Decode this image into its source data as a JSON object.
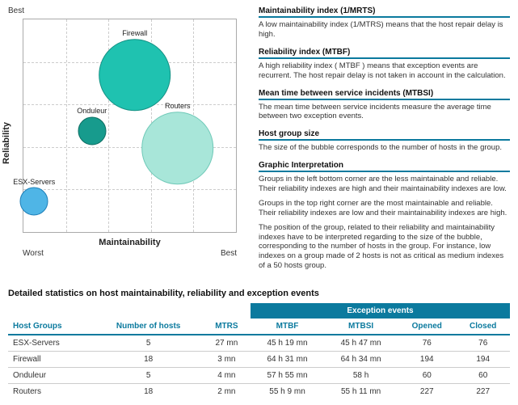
{
  "chart": {
    "best": "Best",
    "worst": "Worst",
    "xlabel": "Maintainability",
    "ylabel": "Reliability"
  },
  "chart_data": {
    "type": "scatter",
    "title": "",
    "xlabel": "Maintainability",
    "ylabel": "Reliability",
    "x_range": [
      "Worst",
      "Best"
    ],
    "y_range": [
      "Worst",
      "Best"
    ],
    "series": [
      {
        "name": "ESX-Servers",
        "x": 0.05,
        "y": 0.15,
        "size": 5,
        "color": "#4fb5e6",
        "border": "#1e7fb8"
      },
      {
        "name": "Onduleur",
        "x": 0.32,
        "y": 0.48,
        "size": 5,
        "color": "#179b8d",
        "border": "#0e6e63"
      },
      {
        "name": "Firewall",
        "x": 0.52,
        "y": 0.74,
        "size": 18,
        "color": "#1fc2b0",
        "border": "#149184"
      },
      {
        "name": "Routers",
        "x": 0.72,
        "y": 0.4,
        "size": 18,
        "color": "#a8e6d9",
        "border": "#6fc9b8"
      }
    ]
  },
  "legend": {
    "s1": {
      "title": "Maintainability index (1/MRTS)",
      "text": "A low maintainability index (1/MTRS) means that the host repair delay is high."
    },
    "s2": {
      "title": "Reliability index (MTBF)",
      "text": "A high reliability index ( MTBF ) means that exception events are recurrent. The host repair delay is not taken in account in the calculation."
    },
    "s3": {
      "title": "Mean time between service incidents (MTBSI)",
      "text": "The mean time between service incidents measure the average time between two exception events."
    },
    "s4": {
      "title": "Host group size",
      "text": "The size of the bubble corresponds to the number of hosts in the group."
    },
    "s5": {
      "title": "Graphic Interpretation",
      "p1": "Groups in the left bottom corner are the less maintainable and reliable. Their reliability indexes are high and their maintainability indexes are low.",
      "p2": "Groups in the top right corner are the most maintainable and reliable. Their reliability indexes are low and their maintainability indexes are high.",
      "p3": "The position of the group, related to their reliability and maintainability indexes have to be interpreted regarding to the size of the bubble, corresponding to the number of hosts in the group. For instance, low indexes on a group made of 2 hosts is not as critical as medium indexes of a 50 hosts group."
    }
  },
  "table": {
    "title": "Detailed statistics on host maintainability, reliability and exception events",
    "group_header": "Exception events",
    "headers": {
      "c0": "Host Groups",
      "c1": "Number of hosts",
      "c2": "MTRS",
      "c3": "MTBF",
      "c4": "MTBSI",
      "c5": "Opened",
      "c6": "Closed"
    },
    "rows": [
      {
        "c0": "ESX-Servers",
        "c1": "5",
        "c2": "27 mn",
        "c3": "45 h 19 mn",
        "c4": "45 h 47 mn",
        "c5": "76",
        "c6": "76"
      },
      {
        "c0": "Firewall",
        "c1": "18",
        "c2": "3 mn",
        "c3": "64 h 31 mn",
        "c4": "64 h 34 mn",
        "c5": "194",
        "c6": "194"
      },
      {
        "c0": "Onduleur",
        "c1": "5",
        "c2": "4 mn",
        "c3": "57 h 55 mn",
        "c4": "58 h",
        "c5": "60",
        "c6": "60"
      },
      {
        "c0": "Routers",
        "c1": "18",
        "c2": "2 mn",
        "c3": "55 h 9 mn",
        "c4": "55 h 11 mn",
        "c5": "227",
        "c6": "227"
      }
    ]
  }
}
